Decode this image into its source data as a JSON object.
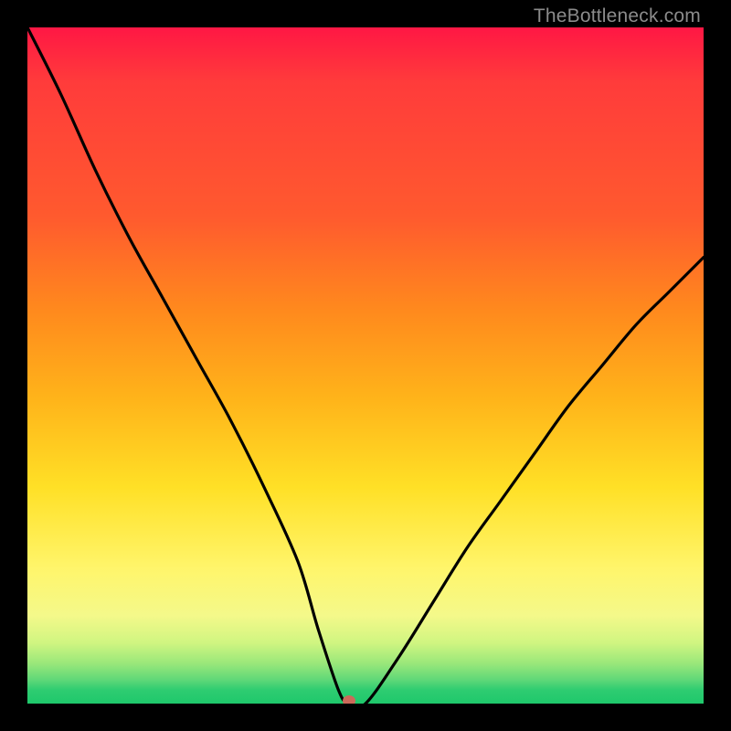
{
  "watermark": "TheBottleneck.com",
  "colors": {
    "background": "#000000",
    "curve_stroke": "#000000",
    "marker_fill": "#cc6a5a",
    "watermark_text": "#8b8b8b",
    "gradient_stops": [
      "#ff1744",
      "#ff3b3b",
      "#ff5a2e",
      "#ff8a1d",
      "#ffb41a",
      "#ffe026",
      "#fff56b",
      "#f4f98a",
      "#d0f581",
      "#9be87a",
      "#5fd878",
      "#2ecc71",
      "#1fc86b"
    ]
  },
  "chart_data": {
    "type": "line",
    "title": "",
    "xlabel": "",
    "ylabel": "",
    "xlim": [
      0,
      1
    ],
    "ylim": [
      0,
      1
    ],
    "note": "x = relative hardware balance position (0..1); y = estimated bottleneck percentage (0..1). Values estimated from the rendered curve.",
    "optimum_marker": {
      "x": 0.475,
      "y": 0.0
    },
    "series": [
      {
        "name": "bottleneck-curve",
        "x": [
          0.0,
          0.05,
          0.1,
          0.15,
          0.2,
          0.25,
          0.3,
          0.35,
          0.4,
          0.43,
          0.46,
          0.475,
          0.5,
          0.55,
          0.6,
          0.65,
          0.7,
          0.75,
          0.8,
          0.85,
          0.9,
          0.95,
          1.0
        ],
        "y": [
          1.0,
          0.9,
          0.79,
          0.69,
          0.6,
          0.51,
          0.42,
          0.32,
          0.21,
          0.11,
          0.02,
          0.0,
          0.0,
          0.07,
          0.15,
          0.23,
          0.3,
          0.37,
          0.44,
          0.5,
          0.56,
          0.61,
          0.66
        ]
      }
    ]
  }
}
